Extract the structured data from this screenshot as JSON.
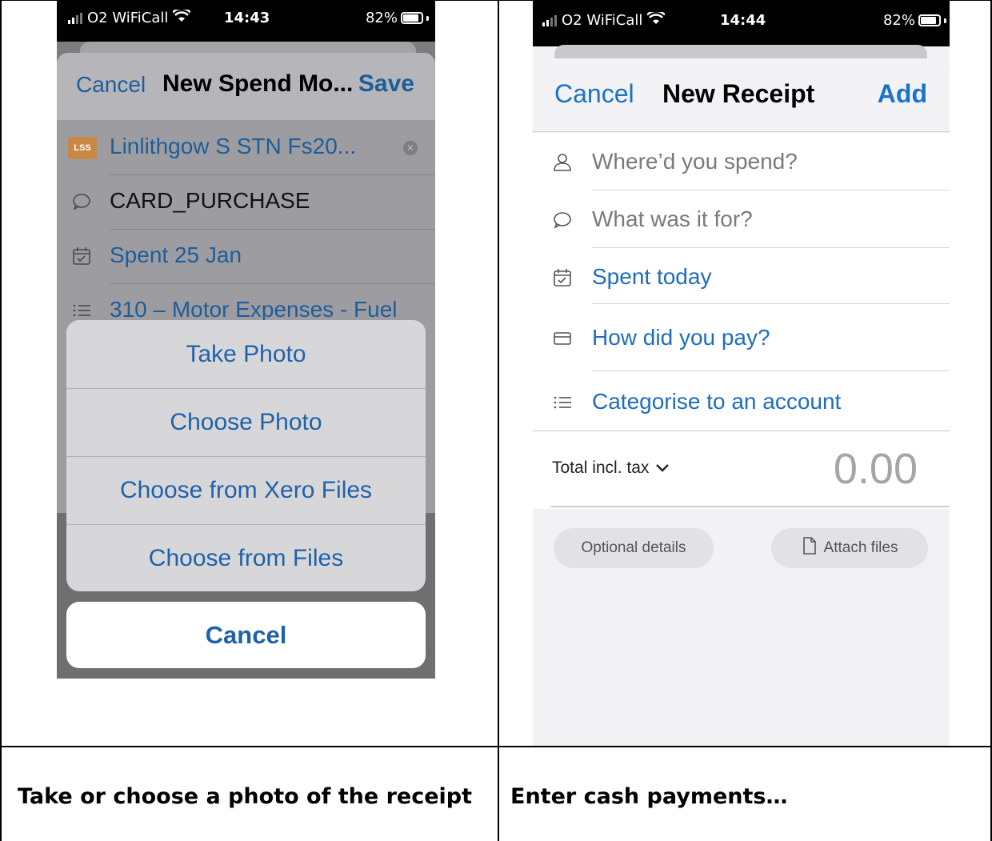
{
  "left_phone": {
    "status": {
      "carrier": "O2 WiFiCall",
      "time": "14:43",
      "battery": "82%"
    },
    "header": {
      "cancel": "Cancel",
      "title": "New Spend Mo...",
      "save": "Save"
    },
    "rows": [
      {
        "icon": "merchant-badge",
        "badge": "LSS",
        "text": "Linlithgow S STN Fs20...",
        "style": "blue"
      },
      {
        "icon": "speech-bubble-icon",
        "text": "CARD_PURCHASE",
        "style": "black"
      },
      {
        "icon": "calendar-icon",
        "text": "Spent 25 Jan",
        "style": "blue"
      },
      {
        "icon": "list-icon",
        "text": "310 – Motor Expenses - Fuel",
        "style": "blue"
      }
    ],
    "action_sheet": [
      "Take Photo",
      "Choose Photo",
      "Choose from Xero Files",
      "Choose from Files"
    ],
    "cancel_button": "Cancel"
  },
  "right_phone": {
    "status": {
      "carrier": "O2 WiFiCall",
      "time": "14:44",
      "battery": "82%"
    },
    "header": {
      "cancel": "Cancel",
      "title": "New Receipt",
      "add": "Add"
    },
    "rows": [
      {
        "icon": "person-icon",
        "text": "Where’d you spend?"
      },
      {
        "icon": "speech-bubble-icon",
        "text": "What was it for?"
      },
      {
        "icon": "calendar-icon",
        "text": "Spent today"
      },
      {
        "icon": "card-icon",
        "text": "How did you pay?"
      },
      {
        "icon": "list-icon",
        "text": "Categorise to an account"
      }
    ],
    "total_label": "Total incl. tax",
    "total_value": "0.00",
    "optional_details": "Optional details",
    "attach_files": "Attach files"
  },
  "captions": {
    "left": "Take or choose a photo of the receipt",
    "right": "Enter cash payments…"
  }
}
